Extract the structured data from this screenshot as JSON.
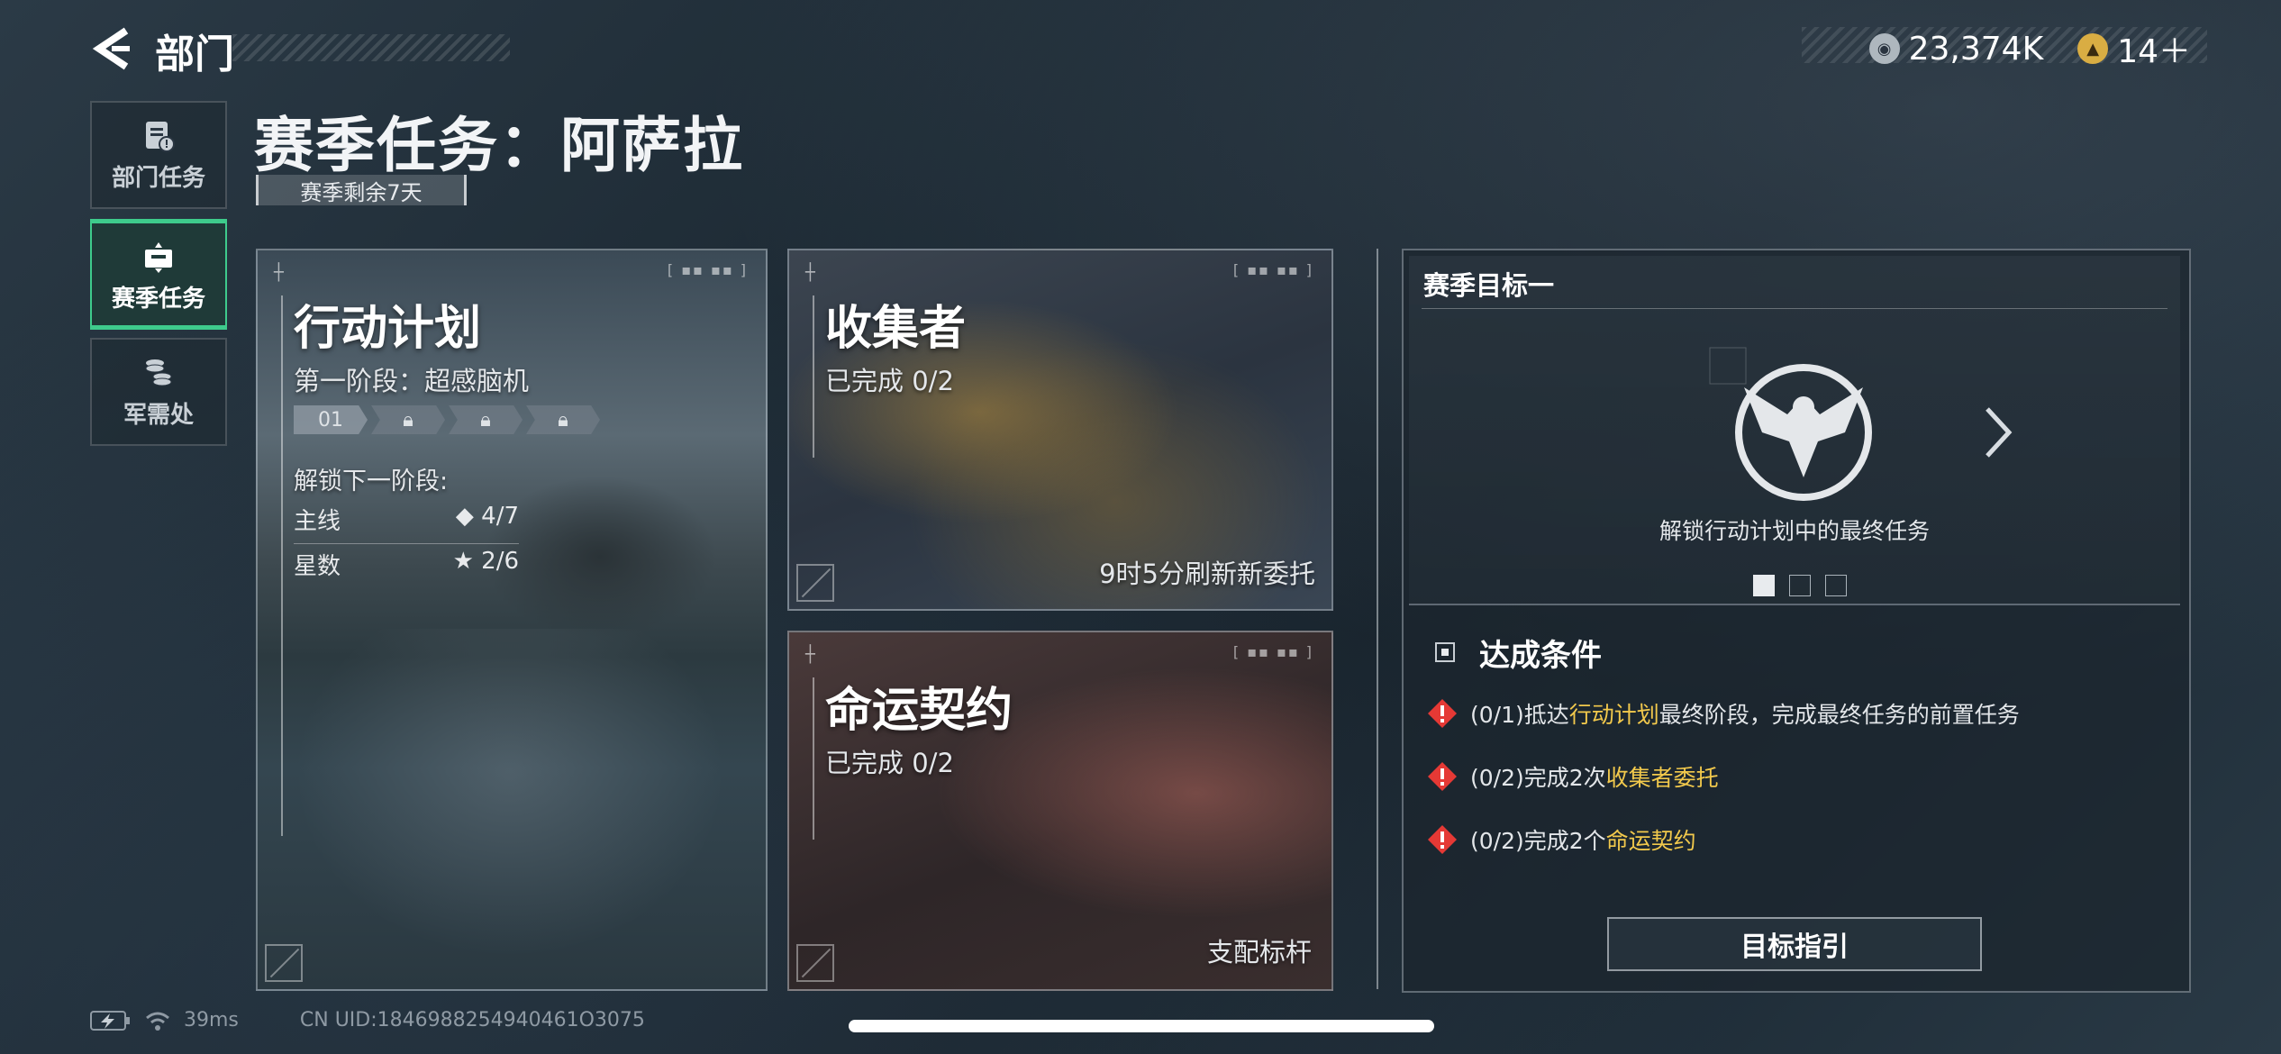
{
  "header": {
    "title": "部门"
  },
  "currency": [
    {
      "name": "credits",
      "value": "23,374K",
      "color": "#b9c2c9"
    },
    {
      "name": "premium",
      "value": "14＋",
      "color": "#e0b64a"
    }
  ],
  "nav": [
    {
      "label": "部门任务",
      "icon": "clipboard-icon",
      "active": false
    },
    {
      "label": "赛季任务",
      "icon": "mission-icon",
      "active": true
    },
    {
      "label": "军需处",
      "icon": "coins-icon",
      "active": false
    }
  ],
  "page": {
    "title": "赛季任务：阿萨拉",
    "remaining": "赛季剩余7天"
  },
  "cards": {
    "action_plan": {
      "title": "行动计划",
      "phase": "第一阶段：超感脑机",
      "stages": [
        "01",
        "",
        "",
        ""
      ],
      "unlock_label": "解锁下一阶段:",
      "main_label": "主线",
      "main_value": "◆ 4/7",
      "stars_label": "星数",
      "stars_value": "★ 2/6"
    },
    "collector": {
      "title": "收集者",
      "progress": "已完成 0/2",
      "refresh": "9时5分刷新新委托"
    },
    "fate": {
      "title": "命运契约",
      "progress": "已完成 0/2",
      "badge": "支配标杆"
    }
  },
  "goal": {
    "title": "赛季目标一",
    "description": "解锁行动计划中的最终任务",
    "conditions_title": "达成条件",
    "conditions": [
      {
        "pre": "(0/1)抵达",
        "hl": "行动计划",
        "post": "最终阶段，完成最终任务的前置任务"
      },
      {
        "pre": "(0/2)完成2次",
        "hl": "收集者委托",
        "post": ""
      },
      {
        "pre": "(0/2)完成2个",
        "hl": "命运契约",
        "post": ""
      }
    ],
    "guide_button": "目标指引"
  },
  "status": {
    "ping": "39ms",
    "uid": "CN UID:1846988254940461O3075"
  },
  "colors": {
    "accent": "#3ecb8c",
    "highlight": "#f2c94c",
    "warning": "#e53935"
  }
}
